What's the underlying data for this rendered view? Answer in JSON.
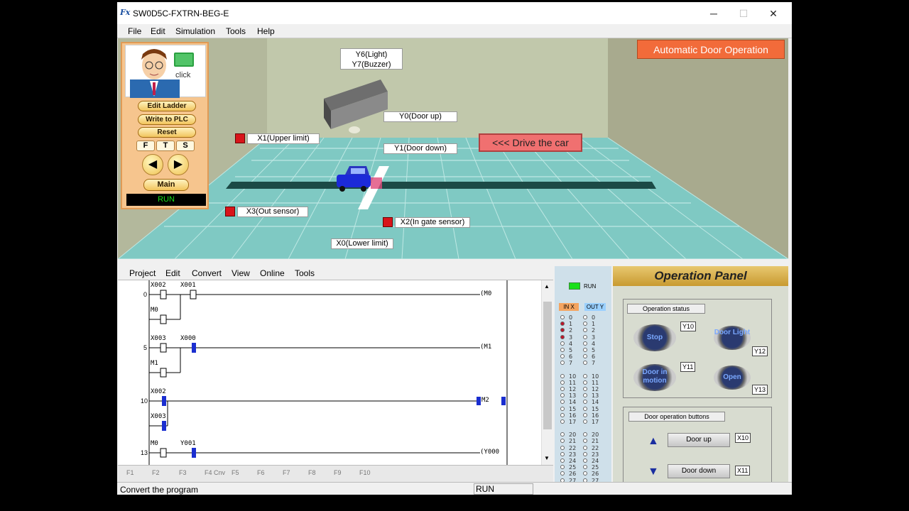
{
  "window": {
    "title": "SW0D5C-FXTRN-BEG-E",
    "menus": [
      "File",
      "Edit",
      "Simulation",
      "Tools",
      "Help"
    ]
  },
  "scene": {
    "banner": "Automatic Door Operation",
    "drive_button": "<<< Drive the car",
    "labels": {
      "y6": "Y6(Light)",
      "y7": "Y7(Buzzer)",
      "y0": "Y0(Door up)",
      "y1": "Y1(Door down)",
      "x1": "X1(Upper limit)",
      "x3": "X3(Out sensor)",
      "x2": "X2(In gate sensor)",
      "x0": "X0(Lower limit)"
    }
  },
  "left_panel": {
    "click": "click",
    "buttons": [
      "Edit Ladder",
      "Write to PLC",
      "Reset"
    ],
    "fts": [
      "F",
      "T",
      "S"
    ],
    "main": "Main",
    "status": "RUN"
  },
  "ladder": {
    "menus": [
      "Project",
      "Edit",
      "Convert",
      "View",
      "Online",
      "Tools"
    ],
    "steps": [
      "0",
      "5",
      "10",
      "13"
    ],
    "contacts": [
      "X002",
      "X001",
      "M0",
      "X003",
      "X000",
      "M1",
      "X002",
      "X003",
      "M0",
      "Y001"
    ],
    "coils": [
      "(M0",
      "(M1",
      "M2",
      "(Y000"
    ],
    "toolbar": [
      "F1",
      "F2",
      "F3",
      "F4 Cnv",
      "F5",
      "F6",
      "F7",
      "F8",
      "F9",
      "F10"
    ]
  },
  "status": {
    "message": "Convert the program",
    "mode": "RUN"
  },
  "io": {
    "run": "RUN",
    "in_label": "IN X",
    "out_label": "OUT Y",
    "numbers": [
      "0",
      "1",
      "2",
      "3",
      "4",
      "5",
      "6",
      "7",
      "10",
      "11",
      "12",
      "13",
      "14",
      "15",
      "16",
      "17",
      "20",
      "21",
      "22",
      "23",
      "24",
      "25",
      "26",
      "27"
    ]
  },
  "operation_panel": {
    "title": "Operation Panel",
    "status_title": "Operation status",
    "status_buttons": {
      "stop": "Stop",
      "light": "Door Light",
      "motion": "Door in motion",
      "open": "Open"
    },
    "status_ylabels": {
      "stop": "Y10",
      "light": "Y12",
      "motion": "Y11",
      "open": "Y13"
    },
    "buttons_title": "Door operation buttons",
    "door_up": "Door up",
    "door_down": "Door down",
    "x10": "X10",
    "x11": "X11"
  },
  "colors": {
    "banner": "#f26b3a",
    "drive": "#f07070",
    "run_green": "#19e019",
    "io_on": "#c0142a"
  }
}
